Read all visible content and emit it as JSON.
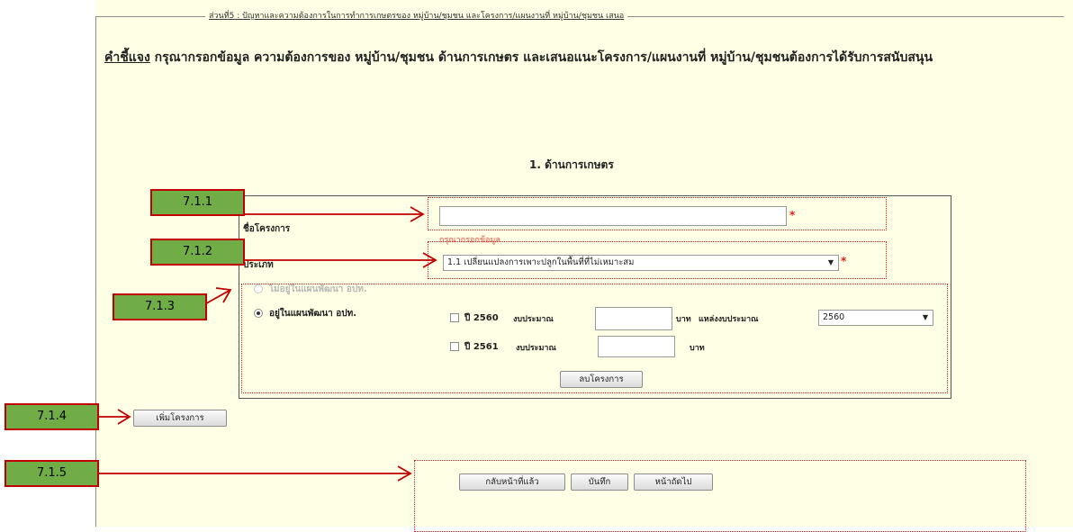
{
  "fieldset": {
    "legend": "ส่วนที่5 : ปัญหาและความต้องการในการทำการเกษตรของ หมู่บ้าน/ชุมชน และโครงการ/แผนงานที่ หมู่บ้าน/ชุมชน เสนอ"
  },
  "instructions": {
    "key": "คำชี้แจง",
    "text": " กรุณากรอกข้อมูล ความต้องการของ หมู่บ้าน/ชุมชน ด้านการเกษตร และเสนอแนะโครงการ/แผนงานที่ หมู่บ้าน/ชุมชนต้องการได้รับการสนับสนุน"
  },
  "section": {
    "title": "1. ด้านการเกษตร"
  },
  "form": {
    "project_name_label": "ชื่อโครงการ",
    "project_name_value": "",
    "required_mark": "*",
    "required_hint": "กรุณากรอกข้อมูล",
    "type_label": "ประเภท",
    "type_selected": "1.1 เปลี่ยนแปลงการเพาะปลูกในพื้นที่ที่ไม่เหมาะสม",
    "plan_radio_no": "ไม่อยู่ในแผนพัฒนา อปท.",
    "plan_radio_yes": "อยู่ในแผนพัฒนา อปท.",
    "year1_label": "ปี 2560",
    "year2_label": "ปี 2561",
    "budget_label": "งบประมาณ",
    "baht_unit": "บาท",
    "budget_source_label": "แหล่งงบประมาณ",
    "budget_source_selected": "2560",
    "year1_budget": "",
    "year2_budget": "",
    "delete_project_button": "ลบโครงการ",
    "add_project_button": "เพิ่มโครงการ",
    "back_button": "กลับหน้าที่แล้ว",
    "save_button": "บันทึก",
    "next_button": "หน้าถัดไป"
  },
  "callouts": {
    "c1": "7.1.1",
    "c2": "7.1.2",
    "c3": "7.1.3",
    "c4": "7.1.4",
    "c5": "7.1.5"
  },
  "colors": {
    "panel_bg": "#ffffe6",
    "callout_fill": "#70ad47",
    "callout_border": "#c00000",
    "required_red": "#e0201c"
  }
}
